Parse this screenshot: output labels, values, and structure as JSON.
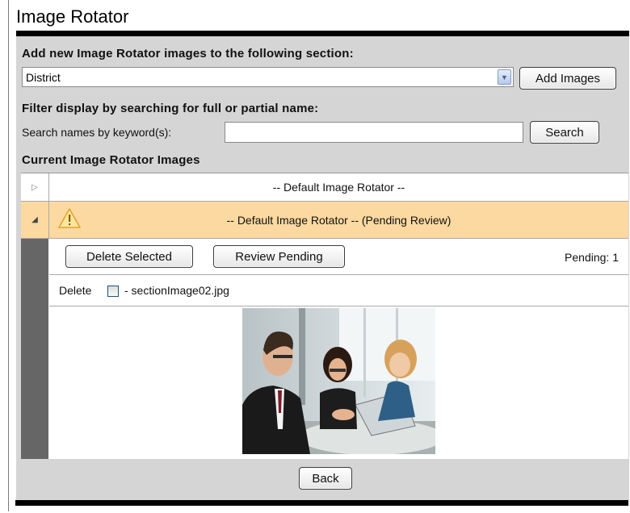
{
  "page": {
    "title": "Image Rotator"
  },
  "add_section": {
    "label": "Add new Image Rotator images to the following section:",
    "selected": "District",
    "add_button": "Add Images"
  },
  "filter": {
    "label": "Filter display by searching for full or partial name:",
    "search_label": "Search names by keyword(s):",
    "search_value": "",
    "search_button": "Search"
  },
  "current": {
    "label": "Current Image Rotator Images",
    "rows": [
      {
        "name": "-- Default Image Rotator --",
        "expanded": false
      },
      {
        "name": "-- Default Image Rotator -- (Pending Review)",
        "expanded": true,
        "icon": "warning-icon"
      }
    ],
    "detail": {
      "delete_selected": "Delete Selected",
      "review_pending": "Review Pending",
      "pending_count": "Pending: 1",
      "items": [
        {
          "delete_label": "Delete",
          "filename": "- sectionImage02.jpg",
          "checked": false
        }
      ]
    }
  },
  "back_button": "Back",
  "colors": {
    "pending_row": "#fbd9a0",
    "panel": "#d5d5d5",
    "title_rule": "#000000",
    "left_bar": "#666666"
  }
}
